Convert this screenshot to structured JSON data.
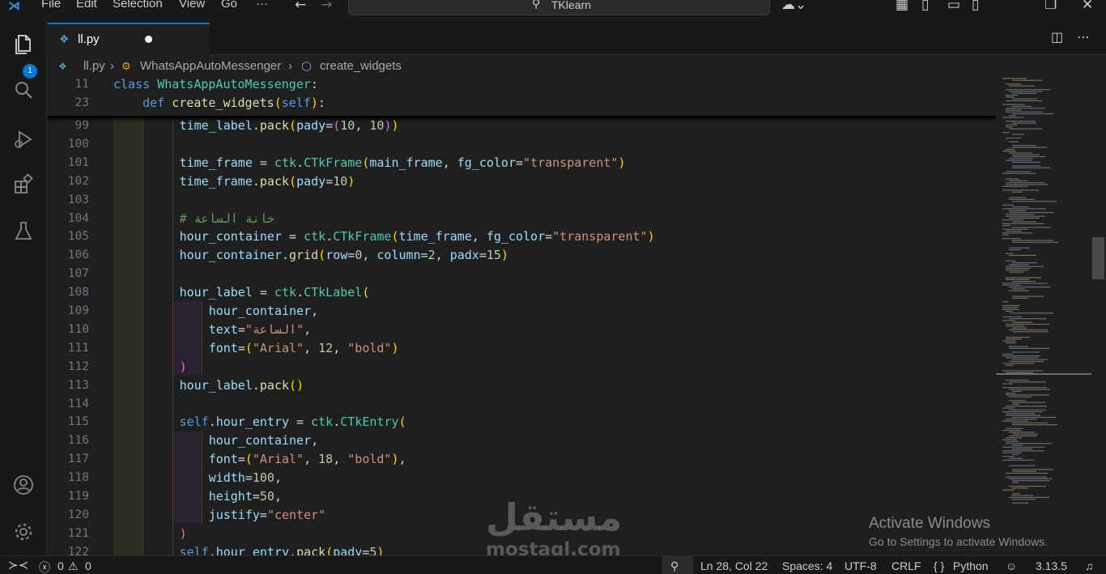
{
  "titlebar": {
    "menu": [
      "File",
      "Edit",
      "Selection",
      "View",
      "Go",
      "···"
    ],
    "search_label": "TKlearn"
  },
  "activity": {
    "explorer_badge": "1"
  },
  "tab": {
    "name": "ll.py"
  },
  "breadcrumb": {
    "file": "ll.py",
    "class": "WhatsAppAutoMessenger",
    "method": "create_widgets"
  },
  "sticky": [
    {
      "ln": "11",
      "code": "class WhatsAppAutoMessenger:"
    },
    {
      "ln": "23",
      "code": "    def create_widgets(self):"
    }
  ],
  "lines": [
    {
      "ln": "99",
      "code": "        time_label.pack(pady=(10, 10))"
    },
    {
      "ln": "100",
      "code": ""
    },
    {
      "ln": "101",
      "code": "        time_frame = ctk.CTkFrame(main_frame, fg_color=\"transparent\")"
    },
    {
      "ln": "102",
      "code": "        time_frame.pack(pady=10)"
    },
    {
      "ln": "103",
      "code": ""
    },
    {
      "ln": "104",
      "code": "        # خانة الساعة"
    },
    {
      "ln": "105",
      "code": "        hour_container = ctk.CTkFrame(time_frame, fg_color=\"transparent\")"
    },
    {
      "ln": "106",
      "code": "        hour_container.grid(row=0, column=2, padx=15)"
    },
    {
      "ln": "107",
      "code": ""
    },
    {
      "ln": "108",
      "code": "        hour_label = ctk.CTkLabel("
    },
    {
      "ln": "109",
      "code": "            hour_container,"
    },
    {
      "ln": "110",
      "code": "            text=\"الساعة\","
    },
    {
      "ln": "111",
      "code": "            font=(\"Arial\", 12, \"bold\")"
    },
    {
      "ln": "112",
      "code": "        )"
    },
    {
      "ln": "113",
      "code": "        hour_label.pack()"
    },
    {
      "ln": "114",
      "code": ""
    },
    {
      "ln": "115",
      "code": "        self.hour_entry = ctk.CTkEntry("
    },
    {
      "ln": "116",
      "code": "            hour_container,"
    },
    {
      "ln": "117",
      "code": "            font=(\"Arial\", 18, \"bold\"),"
    },
    {
      "ln": "118",
      "code": "            width=100,"
    },
    {
      "ln": "119",
      "code": "            height=50,"
    },
    {
      "ln": "120",
      "code": "            justify=\"center\""
    },
    {
      "ln": "121",
      "code": "        )"
    },
    {
      "ln": "122",
      "code": "        self.hour_entry.pack(pady=5)"
    }
  ],
  "watermark": {
    "activate_title": "Activate Windows",
    "activate_sub": "Go to Settings to activate Windows.",
    "brand": "مستقل",
    "brand_url": "mostaql.com"
  },
  "status": {
    "errors": "0",
    "warnings": "0",
    "position": "Ln 28, Col 22",
    "spaces": "Spaces: 4",
    "encoding": "UTF-8",
    "eol": "CRLF",
    "language": "Python",
    "python_version": "3.13.5"
  },
  "colors": {
    "accent": "#0078d4",
    "background": "#1f1f1f",
    "chrome": "#181818"
  }
}
